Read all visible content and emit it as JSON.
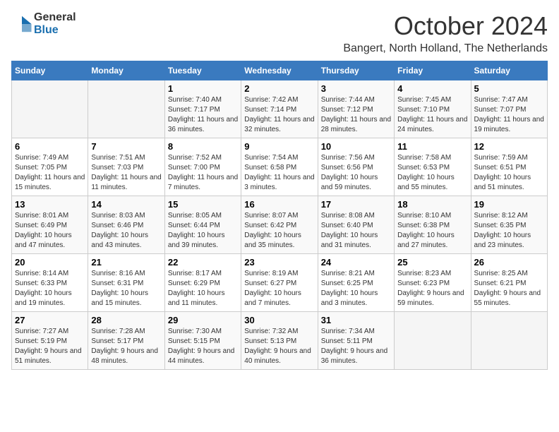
{
  "logo": {
    "general": "General",
    "blue": "Blue"
  },
  "title": "October 2024",
  "location": "Bangert, North Holland, The Netherlands",
  "days_of_week": [
    "Sunday",
    "Monday",
    "Tuesday",
    "Wednesday",
    "Thursday",
    "Friday",
    "Saturday"
  ],
  "weeks": [
    [
      {
        "day": "",
        "info": ""
      },
      {
        "day": "",
        "info": ""
      },
      {
        "day": "1",
        "info": "Sunrise: 7:40 AM\nSunset: 7:17 PM\nDaylight: 11 hours and 36 minutes."
      },
      {
        "day": "2",
        "info": "Sunrise: 7:42 AM\nSunset: 7:14 PM\nDaylight: 11 hours and 32 minutes."
      },
      {
        "day": "3",
        "info": "Sunrise: 7:44 AM\nSunset: 7:12 PM\nDaylight: 11 hours and 28 minutes."
      },
      {
        "day": "4",
        "info": "Sunrise: 7:45 AM\nSunset: 7:10 PM\nDaylight: 11 hours and 24 minutes."
      },
      {
        "day": "5",
        "info": "Sunrise: 7:47 AM\nSunset: 7:07 PM\nDaylight: 11 hours and 19 minutes."
      }
    ],
    [
      {
        "day": "6",
        "info": "Sunrise: 7:49 AM\nSunset: 7:05 PM\nDaylight: 11 hours and 15 minutes."
      },
      {
        "day": "7",
        "info": "Sunrise: 7:51 AM\nSunset: 7:03 PM\nDaylight: 11 hours and 11 minutes."
      },
      {
        "day": "8",
        "info": "Sunrise: 7:52 AM\nSunset: 7:00 PM\nDaylight: 11 hours and 7 minutes."
      },
      {
        "day": "9",
        "info": "Sunrise: 7:54 AM\nSunset: 6:58 PM\nDaylight: 11 hours and 3 minutes."
      },
      {
        "day": "10",
        "info": "Sunrise: 7:56 AM\nSunset: 6:56 PM\nDaylight: 10 hours and 59 minutes."
      },
      {
        "day": "11",
        "info": "Sunrise: 7:58 AM\nSunset: 6:53 PM\nDaylight: 10 hours and 55 minutes."
      },
      {
        "day": "12",
        "info": "Sunrise: 7:59 AM\nSunset: 6:51 PM\nDaylight: 10 hours and 51 minutes."
      }
    ],
    [
      {
        "day": "13",
        "info": "Sunrise: 8:01 AM\nSunset: 6:49 PM\nDaylight: 10 hours and 47 minutes."
      },
      {
        "day": "14",
        "info": "Sunrise: 8:03 AM\nSunset: 6:46 PM\nDaylight: 10 hours and 43 minutes."
      },
      {
        "day": "15",
        "info": "Sunrise: 8:05 AM\nSunset: 6:44 PM\nDaylight: 10 hours and 39 minutes."
      },
      {
        "day": "16",
        "info": "Sunrise: 8:07 AM\nSunset: 6:42 PM\nDaylight: 10 hours and 35 minutes."
      },
      {
        "day": "17",
        "info": "Sunrise: 8:08 AM\nSunset: 6:40 PM\nDaylight: 10 hours and 31 minutes."
      },
      {
        "day": "18",
        "info": "Sunrise: 8:10 AM\nSunset: 6:38 PM\nDaylight: 10 hours and 27 minutes."
      },
      {
        "day": "19",
        "info": "Sunrise: 8:12 AM\nSunset: 6:35 PM\nDaylight: 10 hours and 23 minutes."
      }
    ],
    [
      {
        "day": "20",
        "info": "Sunrise: 8:14 AM\nSunset: 6:33 PM\nDaylight: 10 hours and 19 minutes."
      },
      {
        "day": "21",
        "info": "Sunrise: 8:16 AM\nSunset: 6:31 PM\nDaylight: 10 hours and 15 minutes."
      },
      {
        "day": "22",
        "info": "Sunrise: 8:17 AM\nSunset: 6:29 PM\nDaylight: 10 hours and 11 minutes."
      },
      {
        "day": "23",
        "info": "Sunrise: 8:19 AM\nSunset: 6:27 PM\nDaylight: 10 hours and 7 minutes."
      },
      {
        "day": "24",
        "info": "Sunrise: 8:21 AM\nSunset: 6:25 PM\nDaylight: 10 hours and 3 minutes."
      },
      {
        "day": "25",
        "info": "Sunrise: 8:23 AM\nSunset: 6:23 PM\nDaylight: 9 hours and 59 minutes."
      },
      {
        "day": "26",
        "info": "Sunrise: 8:25 AM\nSunset: 6:21 PM\nDaylight: 9 hours and 55 minutes."
      }
    ],
    [
      {
        "day": "27",
        "info": "Sunrise: 7:27 AM\nSunset: 5:19 PM\nDaylight: 9 hours and 51 minutes."
      },
      {
        "day": "28",
        "info": "Sunrise: 7:28 AM\nSunset: 5:17 PM\nDaylight: 9 hours and 48 minutes."
      },
      {
        "day": "29",
        "info": "Sunrise: 7:30 AM\nSunset: 5:15 PM\nDaylight: 9 hours and 44 minutes."
      },
      {
        "day": "30",
        "info": "Sunrise: 7:32 AM\nSunset: 5:13 PM\nDaylight: 9 hours and 40 minutes."
      },
      {
        "day": "31",
        "info": "Sunrise: 7:34 AM\nSunset: 5:11 PM\nDaylight: 9 hours and 36 minutes."
      },
      {
        "day": "",
        "info": ""
      },
      {
        "day": "",
        "info": ""
      }
    ]
  ]
}
